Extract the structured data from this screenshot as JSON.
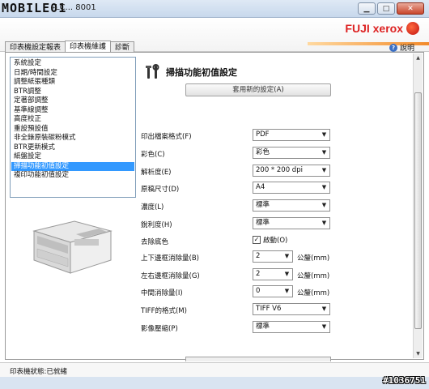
{
  "window": {
    "logo_text": "MOBILE01",
    "title_suffix": "LC... 8001",
    "brand": "FUJI xerox",
    "help_label": "說明",
    "minimize_icon": "minimize-icon",
    "maximize_icon": "maximize-icon",
    "close_icon": "close-icon"
  },
  "tabs": [
    {
      "label": "印表機設定報表",
      "active": false
    },
    {
      "label": "印表機維護",
      "active": true
    },
    {
      "label": "診斷",
      "active": false
    }
  ],
  "sidebar": {
    "items": [
      {
        "label": "系統設定",
        "selected": false
      },
      {
        "label": "日期/時間設定",
        "selected": false
      },
      {
        "label": "調整紙張種類",
        "selected": false
      },
      {
        "label": "BTR調整",
        "selected": false
      },
      {
        "label": "定著部調整",
        "selected": false
      },
      {
        "label": "基準線調整",
        "selected": false
      },
      {
        "label": "高度校正",
        "selected": false
      },
      {
        "label": "重設預設值",
        "selected": false
      },
      {
        "label": "非全錄原裝碳粉模式",
        "selected": false
      },
      {
        "label": "BTR更新模式",
        "selected": false
      },
      {
        "label": "紙盤設定",
        "selected": false
      },
      {
        "label": "掃描功能初值設定",
        "selected": true
      },
      {
        "label": "複印功能初值設定",
        "selected": false
      }
    ]
  },
  "panel": {
    "title": "掃描功能初值設定",
    "apply_button": "套用新的設定(A)",
    "fields": [
      {
        "label": "印出檔案格式(F)",
        "value": "PDF"
      },
      {
        "label": "彩色(C)",
        "value": "彩色"
      },
      {
        "label": "解析度(E)",
        "value": "200 * 200 dpi"
      },
      {
        "label": "原稿尺寸(D)",
        "value": "A4"
      },
      {
        "label": "濃度(L)",
        "value": "標準"
      },
      {
        "label": "銳利度(H)",
        "value": "標準"
      },
      {
        "label": "去除底色",
        "checkbox_label": "啟動(O)",
        "checked": true
      },
      {
        "label": "上下邊框消除量(B)",
        "value": "2",
        "unit": "公釐(mm)"
      },
      {
        "label": "左右邊框消除量(G)",
        "value": "2",
        "unit": "公釐(mm)"
      },
      {
        "label": "中間消除量(I)",
        "value": "0",
        "unit": "公釐(mm)"
      },
      {
        "label": "TIFF的格式(M)",
        "value": "TIFF V6"
      },
      {
        "label": "影像壓縮(P)",
        "value": "標準"
      }
    ]
  },
  "status": {
    "text": "印表機狀態:已就緒"
  },
  "watermark": "#1036751"
}
